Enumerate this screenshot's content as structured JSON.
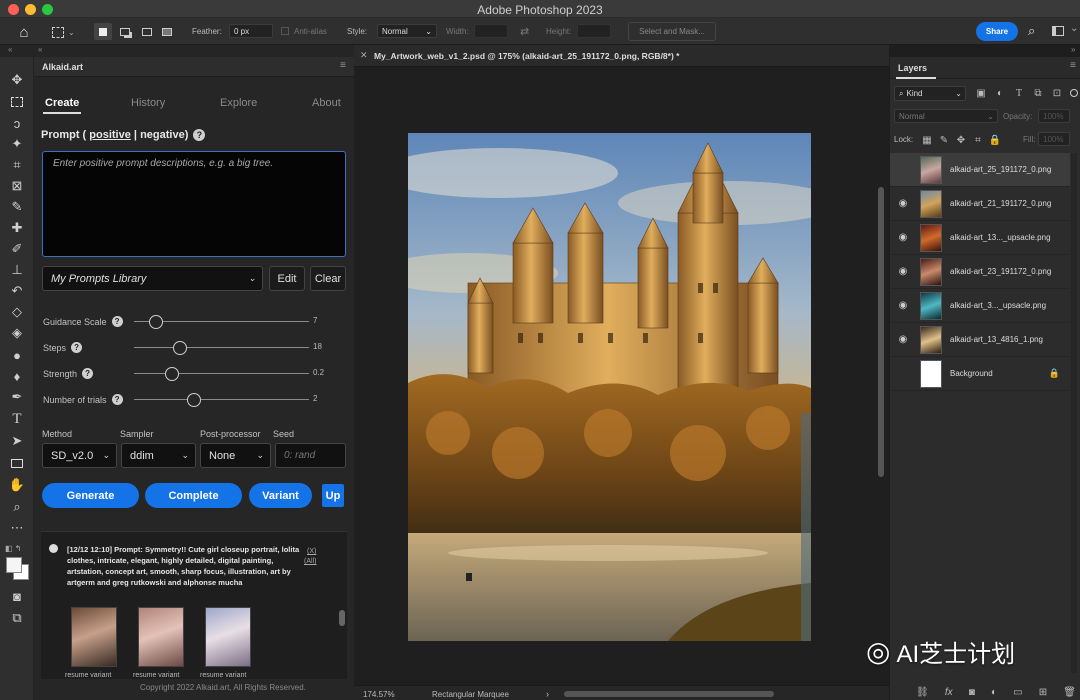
{
  "window": {
    "title": "Adobe Photoshop 2023",
    "share": "Share"
  },
  "options": {
    "feather_label": "Feather:",
    "feather_value": "0 px",
    "antialias": "Anti-alias",
    "style_label": "Style:",
    "style_value": "Normal",
    "width_label": "Width:",
    "height_label": "Height:",
    "select_mask": "Select and Mask..."
  },
  "document": {
    "tab_title": "My_Artwork_web_v1_2.psd @ 175% (alkaid-art_25_191172_0.png, RGB/8*) *",
    "zoom": "174.57%",
    "status_tool": "Rectangular Marquee"
  },
  "plugin": {
    "name": "Alkaid.art",
    "tabs": [
      "Create",
      "History",
      "Explore",
      "About"
    ],
    "prompt_prefix": "Prompt ( ",
    "prompt_positive": "positive",
    "prompt_sep": " | ",
    "prompt_negative": "negative",
    "prompt_suffix": " )",
    "prompt_placeholder": "Enter positive prompt descriptions, e.g. a big tree.",
    "library": "My Prompts Library",
    "edit": "Edit",
    "clear": "Clear",
    "sliders": [
      {
        "label": "Guidance Scale",
        "value": "7",
        "pos": 0.17
      },
      {
        "label": "Steps",
        "value": "18",
        "pos": 0.27
      },
      {
        "label": "Strength",
        "value": "0.2",
        "pos": 0.22
      },
      {
        "label": "Number of trials",
        "value": "2",
        "pos": 0.35
      }
    ],
    "method_label": "Method",
    "sampler_label": "Sampler",
    "post_label": "Post-processor",
    "seed_label": "Seed",
    "method_value": "SD_v2.0",
    "sampler_value": "ddim",
    "post_value": "None",
    "seed_placeholder": "0: rand",
    "buttons": {
      "generate": "Generate",
      "complete": "Complete",
      "variant": "Variant",
      "up": "Up"
    },
    "history_entry": "[12/12 12:10] Prompt: Symmetry!! Cute girl closeup portrait, lolita clothes, intricate, elegant, highly detailed, digital painting, artstation, concept art, smooth, sharp focus, illustration, art by artgerm and greg rutkowski and alphonse mucha",
    "entry_x": "(X)",
    "entry_all": "(All)",
    "thumb_actions": "resume variant",
    "copyright": "Copyright 2022 Alkaid.art, All Rights Reserved."
  },
  "layers": {
    "panel_title": "Layers",
    "kind": "Kind",
    "blend": "Normal",
    "opacity_label": "Opacity:",
    "opacity_value": "100%",
    "lock_label": "Lock:",
    "fill_label": "Fill:",
    "fill_value": "100%",
    "items": [
      {
        "name": "alkaid-art_25_191172_0.png",
        "selected": true
      },
      {
        "name": "alkaid-art_21_191172_0.png"
      },
      {
        "name": "alkaid-art_13..._upsacle.png"
      },
      {
        "name": "alkaid-art_23_191172_0.png"
      },
      {
        "name": "alkaid-art_3..._upsacle.png"
      },
      {
        "name": "alkaid-art_13_4816_1.png"
      },
      {
        "name": "Background"
      }
    ]
  },
  "watermark": "AI芝士计划",
  "colors": {
    "accent": "#1473e6",
    "panel": "#262626",
    "canvas_bg": "#1f1f1f"
  }
}
